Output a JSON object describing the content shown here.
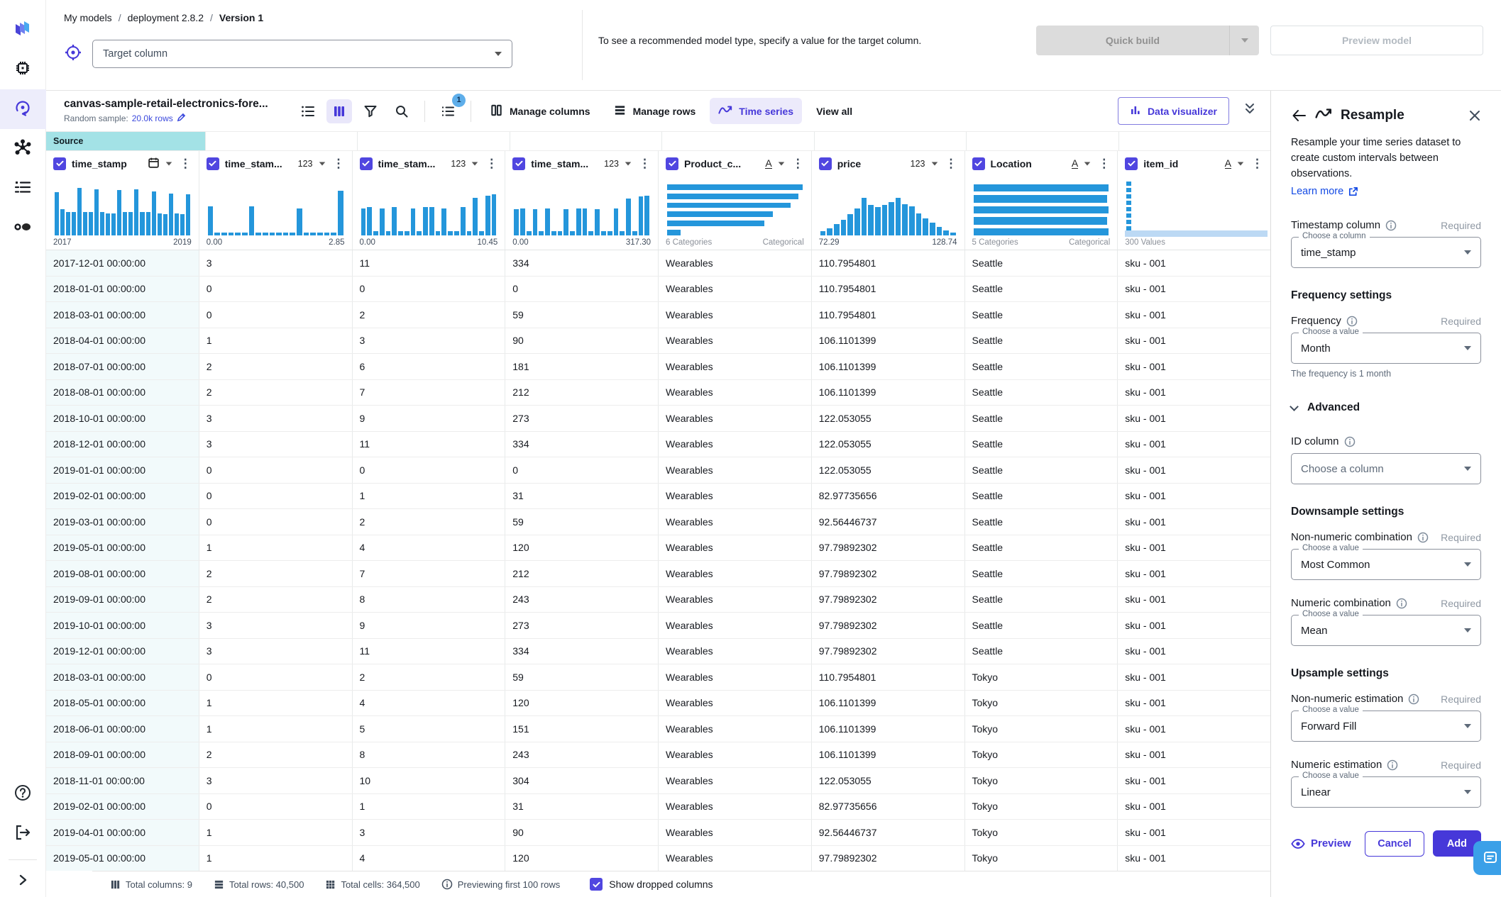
{
  "colors": {
    "accent_purple": "#4638d9",
    "checkbox_purple": "#5046e0",
    "hist_blue": "#2496db",
    "source_teal": "#a3e2e6",
    "link_blue": "#1249e4",
    "chip_bg": "#eceafb"
  },
  "header": {
    "breadcrumb": [
      "My models",
      "deployment 2.8.2",
      "Version 1"
    ],
    "target_placeholder": "Target column",
    "hint": "To see a recommended model type, specify a value for the target column.",
    "quick_build_label": "Quick build",
    "preview_model_label": "Preview model"
  },
  "toolbar": {
    "dataset_title": "canvas-sample-retail-electronics-fore...",
    "random_sample_label": "Random sample:",
    "random_sample_value": "20.0k rows",
    "steps_badge": "1",
    "manage_columns_label": "Manage columns",
    "manage_rows_label": "Manage rows",
    "time_series_label": "Time series",
    "view_all_label": "View all",
    "data_visualizer_label": "Data visualizer"
  },
  "table": {
    "source_tag": "Source",
    "columns": [
      {
        "label": "time_stamp",
        "type": "date",
        "axis_left": "2017",
        "axis_right": "2019",
        "hist": [
          82,
          50,
          44,
          44,
          90,
          44,
          44,
          88,
          44,
          42,
          42,
          86,
          44,
          44,
          88,
          44,
          44,
          84,
          42,
          40,
          80,
          42,
          40,
          78
        ]
      },
      {
        "label": "time_stam...",
        "type": "123",
        "axis_left": "0.00",
        "axis_right": "2.85",
        "hist": [
          55,
          6,
          6,
          6,
          6,
          6,
          55,
          6,
          6,
          6,
          6,
          6,
          6,
          52,
          6,
          6,
          6,
          6,
          6,
          85
        ]
      },
      {
        "label": "time_stam...",
        "type": "123",
        "axis_left": "0.00",
        "axis_right": "10.45",
        "hist": [
          52,
          54,
          8,
          52,
          8,
          54,
          8,
          8,
          52,
          8,
          54,
          54,
          8,
          52,
          8,
          8,
          54,
          8,
          72,
          8,
          76,
          78
        ]
      },
      {
        "label": "time_stam...",
        "type": "123",
        "axis_left": "0.00",
        "axis_right": "317.30",
        "hist": [
          50,
          52,
          8,
          50,
          8,
          52,
          8,
          8,
          50,
          8,
          52,
          52,
          8,
          50,
          8,
          8,
          52,
          8,
          70,
          8,
          74,
          76
        ]
      },
      {
        "label": "Product_c...",
        "type": "A",
        "axis_left": "6 Categories",
        "axis_right": "Categorical",
        "cat_bars": [
          100,
          97,
          91,
          78,
          72,
          10
        ]
      },
      {
        "label": "price",
        "type": "123",
        "axis_left": "72.29",
        "axis_right": "128.74",
        "hist": [
          8,
          14,
          22,
          30,
          40,
          52,
          72,
          58,
          54,
          58,
          64,
          72,
          60,
          56,
          42,
          32,
          24,
          16,
          10,
          6
        ]
      },
      {
        "label": "Location",
        "type": "A",
        "axis_left": "5 Categories",
        "axis_right": "Categorical",
        "cat_bars": [
          100,
          99,
          100,
          99,
          100
        ]
      },
      {
        "label": "item_id",
        "type": "A",
        "axis_left": "300 Values",
        "axis_right": "",
        "id_values": true
      }
    ],
    "rows": [
      [
        "2017-12-01 00:00:00",
        "3",
        "11",
        "334",
        "Wearables",
        "110.7954801",
        "Seattle",
        "sku - 001"
      ],
      [
        "2018-01-01 00:00:00",
        "0",
        "0",
        "0",
        "Wearables",
        "110.7954801",
        "Seattle",
        "sku - 001"
      ],
      [
        "2018-03-01 00:00:00",
        "0",
        "2",
        "59",
        "Wearables",
        "110.7954801",
        "Seattle",
        "sku - 001"
      ],
      [
        "2018-04-01 00:00:00",
        "1",
        "3",
        "90",
        "Wearables",
        "106.1101399",
        "Seattle",
        "sku - 001"
      ],
      [
        "2018-07-01 00:00:00",
        "2",
        "6",
        "181",
        "Wearables",
        "106.1101399",
        "Seattle",
        "sku - 001"
      ],
      [
        "2018-08-01 00:00:00",
        "2",
        "7",
        "212",
        "Wearables",
        "106.1101399",
        "Seattle",
        "sku - 001"
      ],
      [
        "2018-10-01 00:00:00",
        "3",
        "9",
        "273",
        "Wearables",
        "122.053055",
        "Seattle",
        "sku - 001"
      ],
      [
        "2018-12-01 00:00:00",
        "3",
        "11",
        "334",
        "Wearables",
        "122.053055",
        "Seattle",
        "sku - 001"
      ],
      [
        "2019-01-01 00:00:00",
        "0",
        "0",
        "0",
        "Wearables",
        "122.053055",
        "Seattle",
        "sku - 001"
      ],
      [
        "2019-02-01 00:00:00",
        "0",
        "1",
        "31",
        "Wearables",
        "82.97735656",
        "Seattle",
        "sku - 001"
      ],
      [
        "2019-03-01 00:00:00",
        "0",
        "2",
        "59",
        "Wearables",
        "92.56446737",
        "Seattle",
        "sku - 001"
      ],
      [
        "2019-05-01 00:00:00",
        "1",
        "4",
        "120",
        "Wearables",
        "97.79892302",
        "Seattle",
        "sku - 001"
      ],
      [
        "2019-08-01 00:00:00",
        "2",
        "7",
        "212",
        "Wearables",
        "97.79892302",
        "Seattle",
        "sku - 001"
      ],
      [
        "2019-09-01 00:00:00",
        "2",
        "8",
        "243",
        "Wearables",
        "97.79892302",
        "Seattle",
        "sku - 001"
      ],
      [
        "2019-10-01 00:00:00",
        "3",
        "9",
        "273",
        "Wearables",
        "97.79892302",
        "Seattle",
        "sku - 001"
      ],
      [
        "2019-12-01 00:00:00",
        "3",
        "11",
        "334",
        "Wearables",
        "97.79892302",
        "Seattle",
        "sku - 001"
      ],
      [
        "2018-03-01 00:00:00",
        "0",
        "2",
        "59",
        "Wearables",
        "110.7954801",
        "Tokyo",
        "sku - 001"
      ],
      [
        "2018-05-01 00:00:00",
        "1",
        "4",
        "120",
        "Wearables",
        "106.1101399",
        "Tokyo",
        "sku - 001"
      ],
      [
        "2018-06-01 00:00:00",
        "1",
        "5",
        "151",
        "Wearables",
        "106.1101399",
        "Tokyo",
        "sku - 001"
      ],
      [
        "2018-09-01 00:00:00",
        "2",
        "8",
        "243",
        "Wearables",
        "106.1101399",
        "Tokyo",
        "sku - 001"
      ],
      [
        "2018-11-01 00:00:00",
        "3",
        "10",
        "304",
        "Wearables",
        "122.053055",
        "Tokyo",
        "sku - 001"
      ],
      [
        "2019-02-01 00:00:00",
        "0",
        "1",
        "31",
        "Wearables",
        "82.97735656",
        "Tokyo",
        "sku - 001"
      ],
      [
        "2019-04-01 00:00:00",
        "1",
        "3",
        "90",
        "Wearables",
        "92.56446737",
        "Tokyo",
        "sku - 001"
      ],
      [
        "2019-05-01 00:00:00",
        "1",
        "4",
        "120",
        "Wearables",
        "97.79892302",
        "Tokyo",
        "sku - 001"
      ]
    ]
  },
  "status_bar": {
    "total_columns": "Total columns: 9",
    "total_rows": "Total rows: 40,500",
    "total_cells": "Total cells: 364,500",
    "previewing": "Previewing first 100 rows",
    "show_dropped": "Show dropped columns"
  },
  "panel": {
    "title": "Resample",
    "description": "Resample your time series dataset to create custom intervals between observations.",
    "learn_more": "Learn more",
    "required_label": "Required",
    "blocks": [
      {
        "kind": "field",
        "label": "Timestamp column",
        "info": true,
        "required": true,
        "legend": "Choose a column",
        "value": "time_stamp"
      },
      {
        "kind": "heading",
        "text": "Frequency settings"
      },
      {
        "kind": "field",
        "label": "Frequency",
        "info": true,
        "required": true,
        "legend": "Choose a value",
        "value": "Month",
        "helper": "The frequency is 1 month"
      },
      {
        "kind": "advanced",
        "text": "Advanced"
      },
      {
        "kind": "field",
        "label": "ID column",
        "info": true,
        "required": false,
        "placeholder": "Choose a column"
      },
      {
        "kind": "heading",
        "text": "Downsample settings"
      },
      {
        "kind": "field",
        "label": "Non-numeric combination",
        "info": true,
        "required": true,
        "legend": "Choose a value",
        "value": "Most Common"
      },
      {
        "kind": "field",
        "label": "Numeric combination",
        "info": true,
        "required": true,
        "legend": "Choose a value",
        "value": "Mean"
      },
      {
        "kind": "heading",
        "text": "Upsample settings"
      },
      {
        "kind": "field",
        "label": "Non-numeric estimation",
        "info": true,
        "required": true,
        "legend": "Choose a value",
        "value": "Forward Fill"
      },
      {
        "kind": "field",
        "label": "Numeric estimation",
        "info": true,
        "required": true,
        "legend": "Choose a value",
        "value": "Linear"
      }
    ],
    "preview_label": "Preview",
    "cancel_label": "Cancel",
    "add_label": "Add"
  },
  "sidebar": {
    "items": [
      "logo",
      "processor",
      "canvas-ai",
      "workflow",
      "list",
      "visuals"
    ],
    "bottom_items": [
      "help",
      "sign-out",
      "expand"
    ]
  }
}
